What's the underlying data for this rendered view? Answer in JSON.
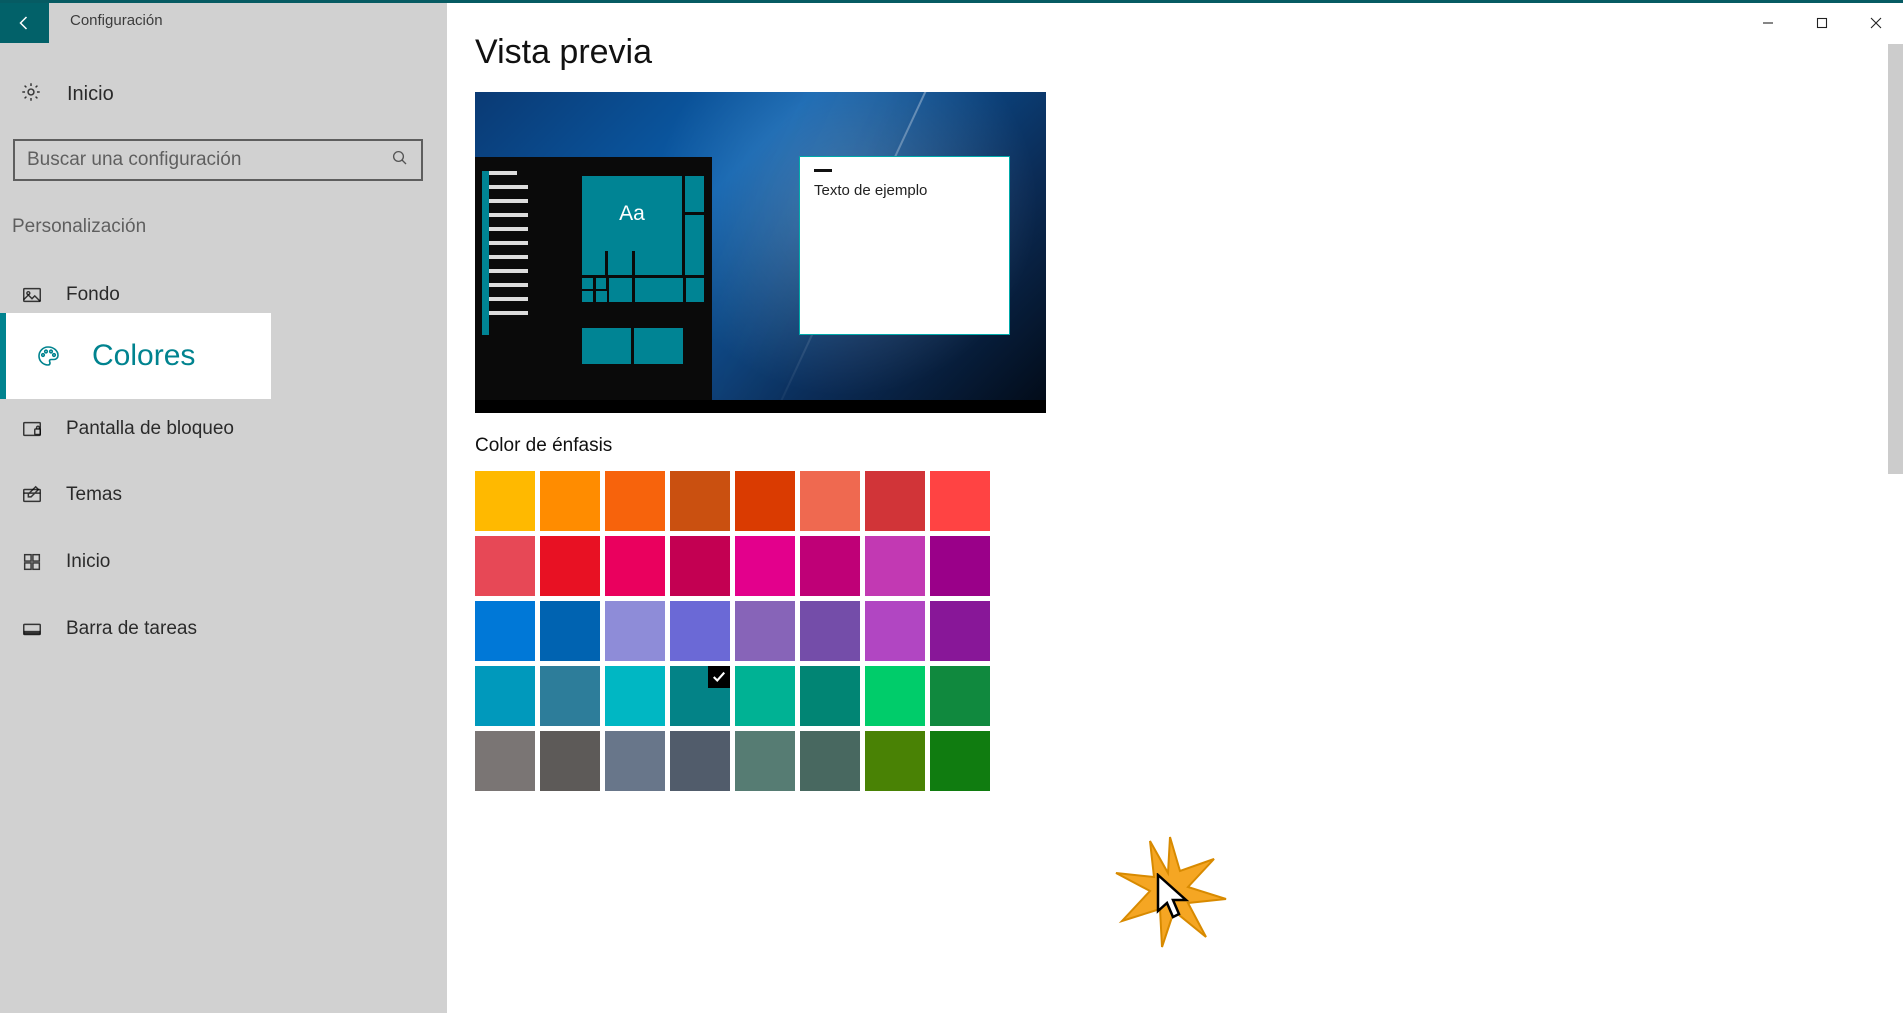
{
  "titlebar": {
    "title": "Configuración"
  },
  "sidebar": {
    "home": "Inicio",
    "search_placeholder": "Buscar una configuración",
    "section": "Personalización",
    "items": [
      {
        "id": "fondo",
        "label": "Fondo",
        "icon": "image-icon"
      },
      {
        "id": "colores",
        "label": "Colores",
        "icon": "palette-icon",
        "active": true
      },
      {
        "id": "bloqueo",
        "label": "Pantalla de bloqueo",
        "icon": "lock-screen-icon"
      },
      {
        "id": "temas",
        "label": "Temas",
        "icon": "themes-icon"
      },
      {
        "id": "inicio2",
        "label": "Inicio",
        "icon": "start-icon"
      },
      {
        "id": "barra",
        "label": "Barra de tareas",
        "icon": "taskbar-icon"
      }
    ]
  },
  "content": {
    "preview_heading": "Vista previa",
    "sample_text": "Texto de ejemplo",
    "accent_heading": "Color de énfasis",
    "accent_color": "#008494",
    "selected_index": 27,
    "swatches": [
      "#ffb900",
      "#ff8c00",
      "#f7630c",
      "#ca5010",
      "#da3b01",
      "#ef6950",
      "#d13438",
      "#ff4343",
      "#e74856",
      "#e81123",
      "#ea005e",
      "#c30052",
      "#e3008c",
      "#bf0077",
      "#c239b3",
      "#9a0089",
      "#0078d7",
      "#0063b1",
      "#8e8cd8",
      "#6b69d6",
      "#8764b8",
      "#744da9",
      "#b146c2",
      "#881798",
      "#0099bc",
      "#2d7d9a",
      "#00b7c3",
      "#038387",
      "#00b294",
      "#018574",
      "#00cc6a",
      "#10893e",
      "#7a7574",
      "#5d5a58",
      "#68768a",
      "#515c6b",
      "#567c73",
      "#486860",
      "#498205",
      "#107c10"
    ]
  }
}
